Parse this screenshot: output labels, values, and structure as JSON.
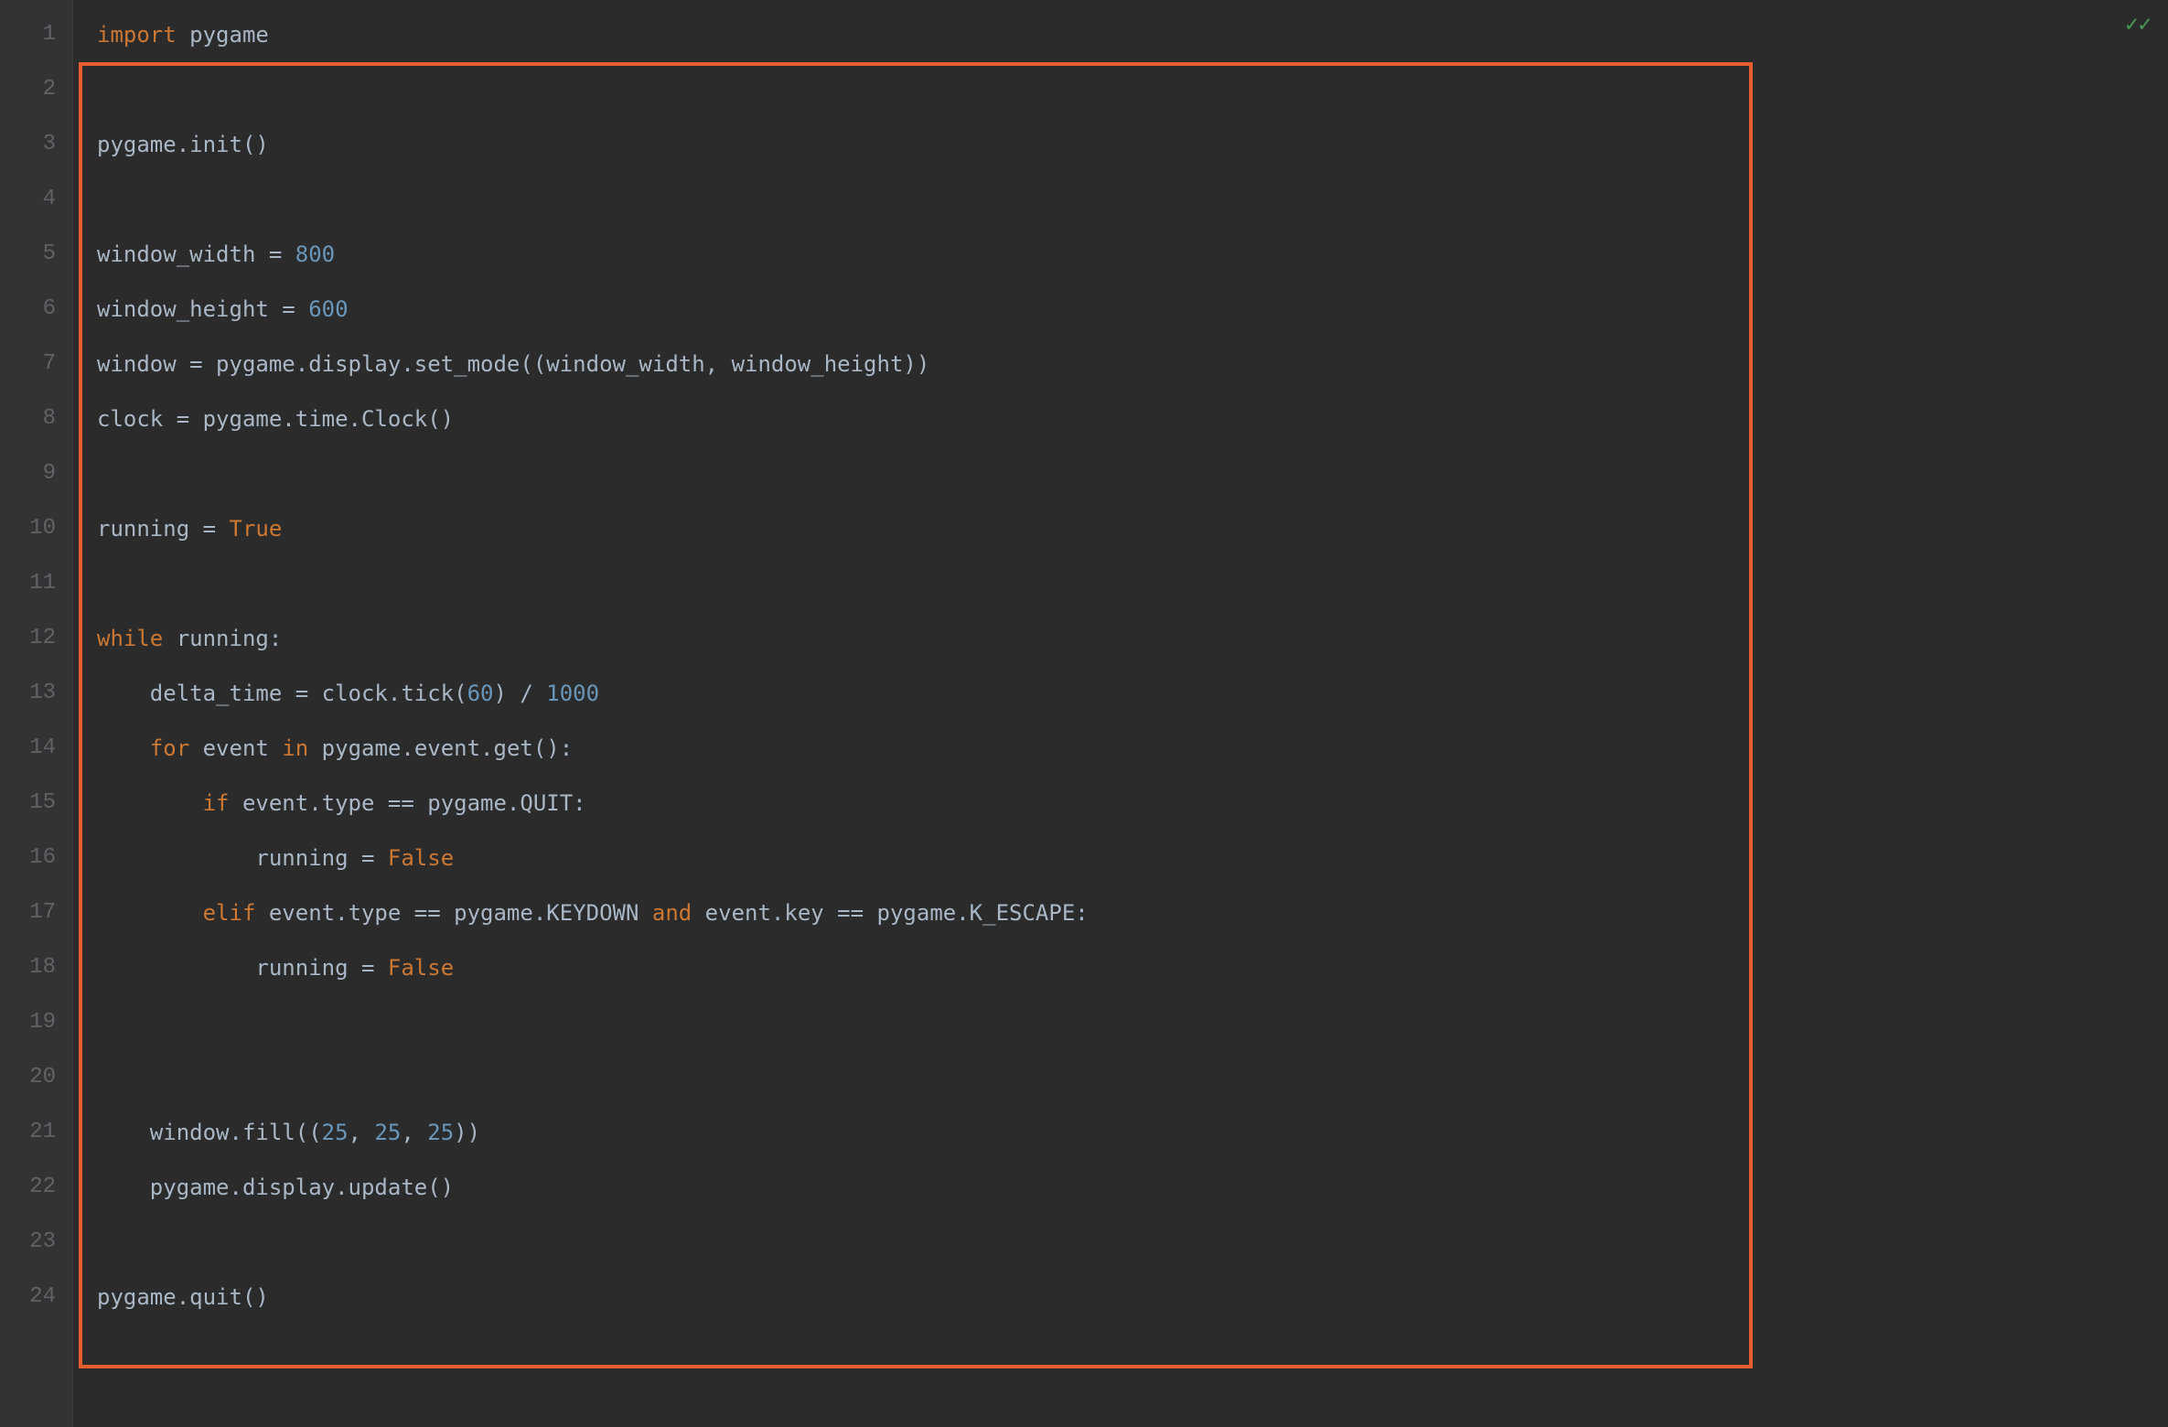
{
  "status": {
    "icon_glyph": "✓✓"
  },
  "highlight": {
    "color": "#e65c2e"
  },
  "lines": [
    {
      "n": 1,
      "fold": "",
      "segments": [
        {
          "t": "import",
          "c": "kw"
        },
        {
          "t": " ",
          "c": "op"
        },
        {
          "t": "pygame",
          "c": "id"
        }
      ]
    },
    {
      "n": 2,
      "fold": "",
      "segments": []
    },
    {
      "n": 3,
      "fold": "",
      "segments": [
        {
          "t": "pygame.init()",
          "c": "id"
        }
      ]
    },
    {
      "n": 4,
      "fold": "",
      "segments": []
    },
    {
      "n": 5,
      "fold": "",
      "segments": [
        {
          "t": "window_width = ",
          "c": "id"
        },
        {
          "t": "800",
          "c": "num"
        }
      ]
    },
    {
      "n": 6,
      "fold": "",
      "segments": [
        {
          "t": "window_height = ",
          "c": "id"
        },
        {
          "t": "600",
          "c": "num"
        }
      ]
    },
    {
      "n": 7,
      "fold": "",
      "segments": [
        {
          "t": "window = pygame.display.set_mode((window_width, window_height))",
          "c": "id"
        }
      ]
    },
    {
      "n": 8,
      "fold": "",
      "segments": [
        {
          "t": "clock = pygame.time.Clock()",
          "c": "id"
        }
      ]
    },
    {
      "n": 9,
      "fold": "",
      "segments": []
    },
    {
      "n": 10,
      "fold": "",
      "segments": [
        {
          "t": "running = ",
          "c": "id"
        },
        {
          "t": "True",
          "c": "const"
        }
      ]
    },
    {
      "n": 11,
      "fold": "",
      "segments": []
    },
    {
      "n": 12,
      "fold": "⊟",
      "segments": [
        {
          "t": "while",
          "c": "kw"
        },
        {
          "t": " running:",
          "c": "id"
        }
      ]
    },
    {
      "n": 13,
      "fold": "",
      "segments": [
        {
          "t": "    delta_time = clock.tick(",
          "c": "id"
        },
        {
          "t": "60",
          "c": "num"
        },
        {
          "t": ") / ",
          "c": "id"
        },
        {
          "t": "1000",
          "c": "num"
        }
      ]
    },
    {
      "n": 14,
      "fold": "⊟",
      "segments": [
        {
          "t": "    ",
          "c": "id"
        },
        {
          "t": "for",
          "c": "kw"
        },
        {
          "t": " event ",
          "c": "id"
        },
        {
          "t": "in",
          "c": "kw"
        },
        {
          "t": " pygame.event.get():",
          "c": "id"
        }
      ]
    },
    {
      "n": 15,
      "fold": "",
      "segments": [
        {
          "t": "        ",
          "c": "id"
        },
        {
          "t": "if",
          "c": "kw"
        },
        {
          "t": " event.type == pygame.QUIT:",
          "c": "id"
        }
      ]
    },
    {
      "n": 16,
      "fold": "",
      "segments": [
        {
          "t": "            running = ",
          "c": "id"
        },
        {
          "t": "False",
          "c": "const"
        }
      ]
    },
    {
      "n": 17,
      "fold": "",
      "segments": [
        {
          "t": "        ",
          "c": "id"
        },
        {
          "t": "elif",
          "c": "kw"
        },
        {
          "t": " event.type == pygame.KEYDOWN ",
          "c": "id"
        },
        {
          "t": "and",
          "c": "kw"
        },
        {
          "t": " event.key == pygame.K_ESCAPE:",
          "c": "id"
        }
      ]
    },
    {
      "n": 18,
      "fold": "⊡",
      "segments": [
        {
          "t": "            running = ",
          "c": "id"
        },
        {
          "t": "False",
          "c": "const"
        }
      ]
    },
    {
      "n": 19,
      "fold": "",
      "segments": []
    },
    {
      "n": 20,
      "fold": "",
      "segments": []
    },
    {
      "n": 21,
      "fold": "",
      "segments": [
        {
          "t": "    window.fill((",
          "c": "id"
        },
        {
          "t": "25",
          "c": "num"
        },
        {
          "t": ", ",
          "c": "id"
        },
        {
          "t": "25",
          "c": "num"
        },
        {
          "t": ", ",
          "c": "id"
        },
        {
          "t": "25",
          "c": "num"
        },
        {
          "t": "))",
          "c": "id"
        }
      ]
    },
    {
      "n": 22,
      "fold": "⊡",
      "segments": [
        {
          "t": "    pygame.display.update()",
          "c": "id"
        }
      ]
    },
    {
      "n": 23,
      "fold": "",
      "segments": []
    },
    {
      "n": 24,
      "fold": "",
      "segments": [
        {
          "t": "pygame.quit()",
          "c": "id"
        }
      ]
    }
  ]
}
